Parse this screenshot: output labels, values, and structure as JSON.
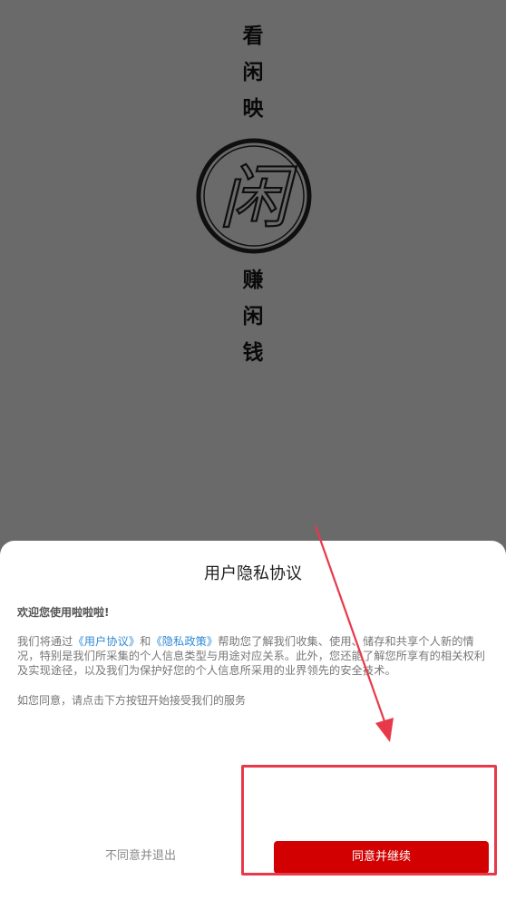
{
  "splash": {
    "top_chars": [
      "看",
      "闲",
      "映"
    ],
    "logo_char": "闲",
    "bottom_chars": [
      "赚",
      "闲",
      "钱"
    ]
  },
  "dialog": {
    "title": "用户隐私协议",
    "welcome": "欢迎您使用啦啦啦!",
    "body": {
      "part1": "我们将通过",
      "link_user": "《用户协议》",
      "part2": "和",
      "link_privacy": "《隐私政策》",
      "part3": "帮助您了解我们收集、使用、储存和共享个人新的情况，特别是我们所采集的个人信息类型与用途对应关系。此外，您还能了解您所享有的相关权利及实现途径，以及我们为保护好您的个人信息所采用的业界领先的安全技术。"
    },
    "consent": "如您同意，请点击下方按钮开始接受我们的服务",
    "disagree_label": "不同意并退出",
    "agree_label": "同意并继续"
  },
  "colors": {
    "accent": "#d20000",
    "link": "#2f8ad6",
    "annotation": "#e8394a"
  }
}
